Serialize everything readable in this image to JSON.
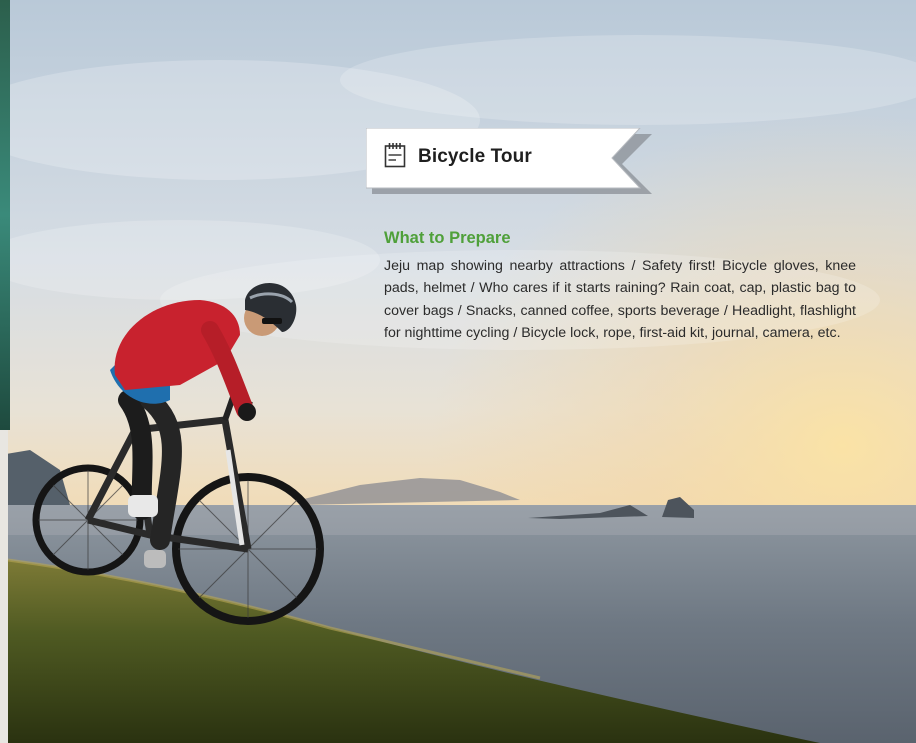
{
  "banner": {
    "title": "Bicycle Tour",
    "icon": "notepad-icon"
  },
  "prepare": {
    "heading": "What to Prepare",
    "body": "Jeju map showing nearby attractions / Safety first! Bicycle gloves, knee pads, helmet / Who cares if it starts raining? Rain coat, cap, plastic bag to cover bags / Snacks, canned coffee, sports beverage / Headlight, flashlight for nighttime cycling / Bicycle lock, rope, first-aid kit, journal, camera, etc."
  },
  "colors": {
    "heading_green": "#4fa03a",
    "body_text": "#2b2b2b",
    "banner_fill": "#ffffff",
    "banner_shadow": "#8a8f95"
  }
}
